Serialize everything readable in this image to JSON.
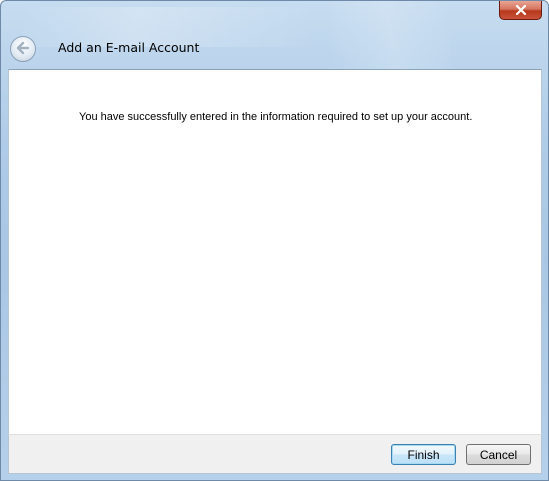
{
  "window": {
    "title": "Add an E-mail Account"
  },
  "titlebar": {
    "close_icon": "close-icon",
    "back_icon": "back-arrow-icon"
  },
  "content": {
    "message": "You have successfully entered in the information required to set up your account."
  },
  "footer": {
    "finish_label": "Finish",
    "cancel_label": "Cancel"
  },
  "colors": {
    "frame": "#a9c7e4",
    "close_button": "#c8533a",
    "default_button_border": "#3c7fb1"
  }
}
